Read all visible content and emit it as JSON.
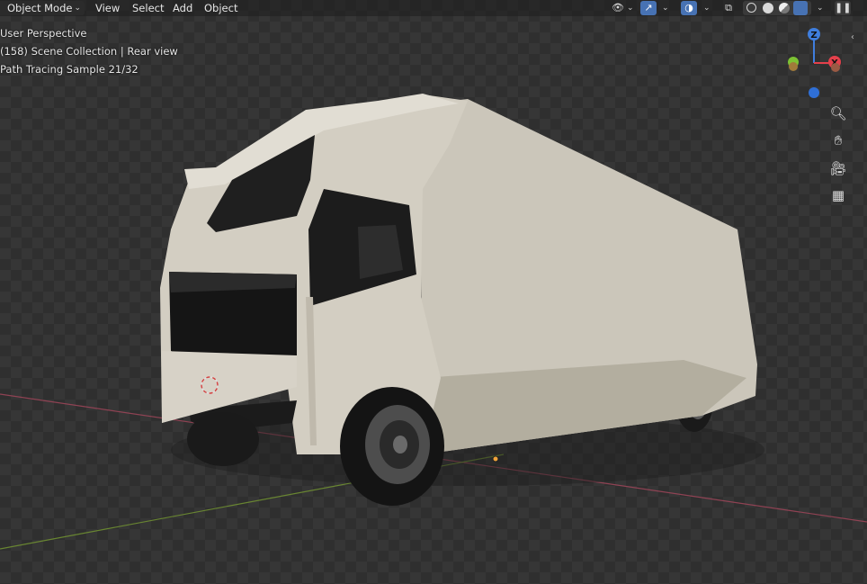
{
  "header": {
    "mode": "Object Mode",
    "menus": [
      "View",
      "Select",
      "Add",
      "Object"
    ],
    "icons": [
      "visibility-icon",
      "gizmo-toggle-icon",
      "overlay-toggle-icon",
      "xray-icon",
      "wireframe-shading-icon",
      "solid-shading-icon",
      "material-shading-icon",
      "rendered-shading-icon",
      "pause-icon"
    ]
  },
  "viewport_info": {
    "perspective": "User Perspective",
    "collection": "(158) Scene Collection | Rear view",
    "render_status": "Path Tracing Sample 21/32"
  },
  "gizmo": {
    "x_label": "X",
    "z_label": "Z",
    "x_color": "#e4404b",
    "y_color": "#7cc233",
    "z_color": "#3f7ede"
  },
  "nav_tools": [
    "zoom-icon",
    "pan-hand-icon",
    "camera-view-icon",
    "orthographic-grid-icon"
  ],
  "colors": {
    "accent": "#4772b3",
    "truck_body": "#cdc8bc",
    "x_axis": "#a8465a",
    "y_axis": "#7a9a36"
  }
}
